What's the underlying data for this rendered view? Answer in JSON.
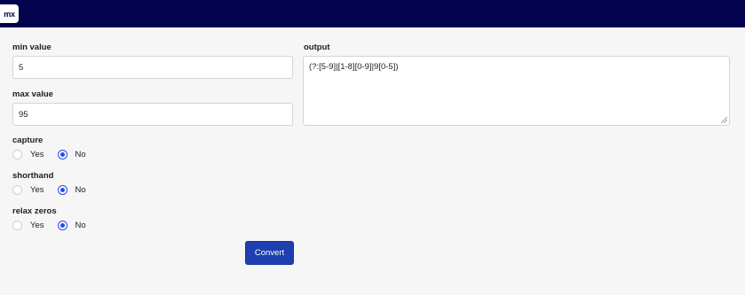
{
  "header": {
    "logo_text": "mx",
    "bar_color": "#02024f"
  },
  "form": {
    "min_label": "min value",
    "min_value": "5",
    "max_label": "max value",
    "max_value": "95",
    "output_label": "output",
    "output_value": "(?:[5-9]|[1-8][0-9]|9[0-5])",
    "capture": {
      "label": "capture",
      "yes": "Yes",
      "no": "No",
      "selected": "No"
    },
    "shorthand": {
      "label": "shorthand",
      "yes": "Yes",
      "no": "No",
      "selected": "No"
    },
    "relax_zeros": {
      "label": "relax zeros",
      "yes": "Yes",
      "no": "No",
      "selected": "No"
    },
    "convert_label": "Convert"
  },
  "colors": {
    "accent": "#264ae5",
    "button": "#1f3fb0"
  }
}
